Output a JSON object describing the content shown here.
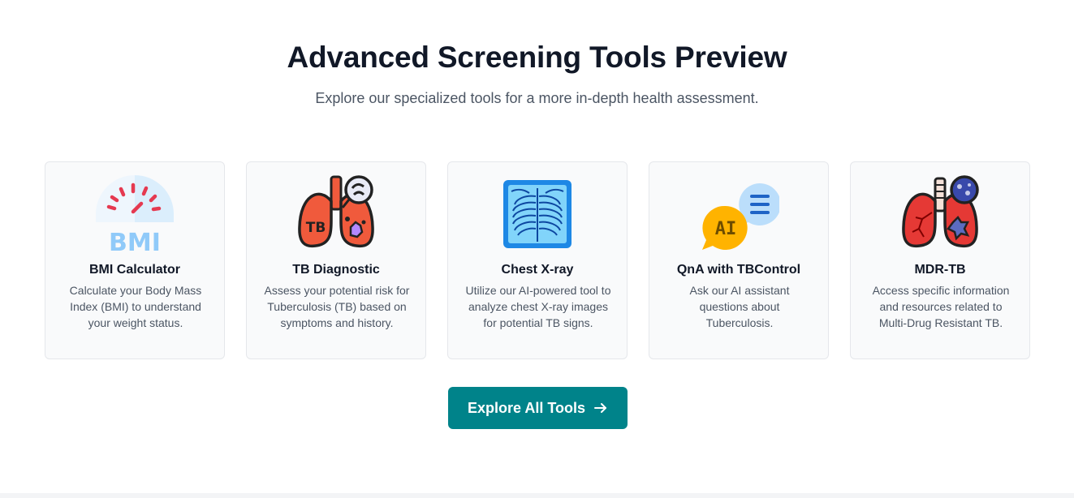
{
  "header": {
    "title": "Advanced Screening Tools Preview",
    "subtitle": "Explore our specialized tools for a more in-depth health assessment."
  },
  "tools": [
    {
      "title": "BMI Calculator",
      "description": "Calculate your Body Mass Index (BMI) to understand your weight status.",
      "icon": "bmi-gauge-icon",
      "icon_text": "BMI"
    },
    {
      "title": "TB Diagnostic",
      "description": "Assess your potential risk for Tuberculosis (TB) based on symptoms and history.",
      "icon": "tb-lungs-icon",
      "icon_text": "TB"
    },
    {
      "title": "Chest X-ray",
      "description": "Utilize our AI-powered tool to analyze chest X-ray images for potential TB signs.",
      "icon": "chest-xray-icon"
    },
    {
      "title": "QnA with TBControl",
      "description": "Ask our AI assistant questions about Tuberculosis.",
      "icon": "ai-chat-icon",
      "icon_text": "AI"
    },
    {
      "title": "MDR-TB",
      "description": "Access specific information and resources related to Multi-Drug Resistant TB.",
      "icon": "mdr-lungs-icon"
    }
  ],
  "cta": {
    "label": "Explore All Tools",
    "icon": "arrow-right-icon"
  },
  "colors": {
    "primary": "#00838a",
    "card_bg": "#f9fafb",
    "card_border": "#e5e7eb",
    "heading": "#111827",
    "muted": "#4b5563",
    "lung_red": "#f05a3c",
    "bmi_blue": "#90caf9",
    "ai_orange": "#ffb300"
  }
}
